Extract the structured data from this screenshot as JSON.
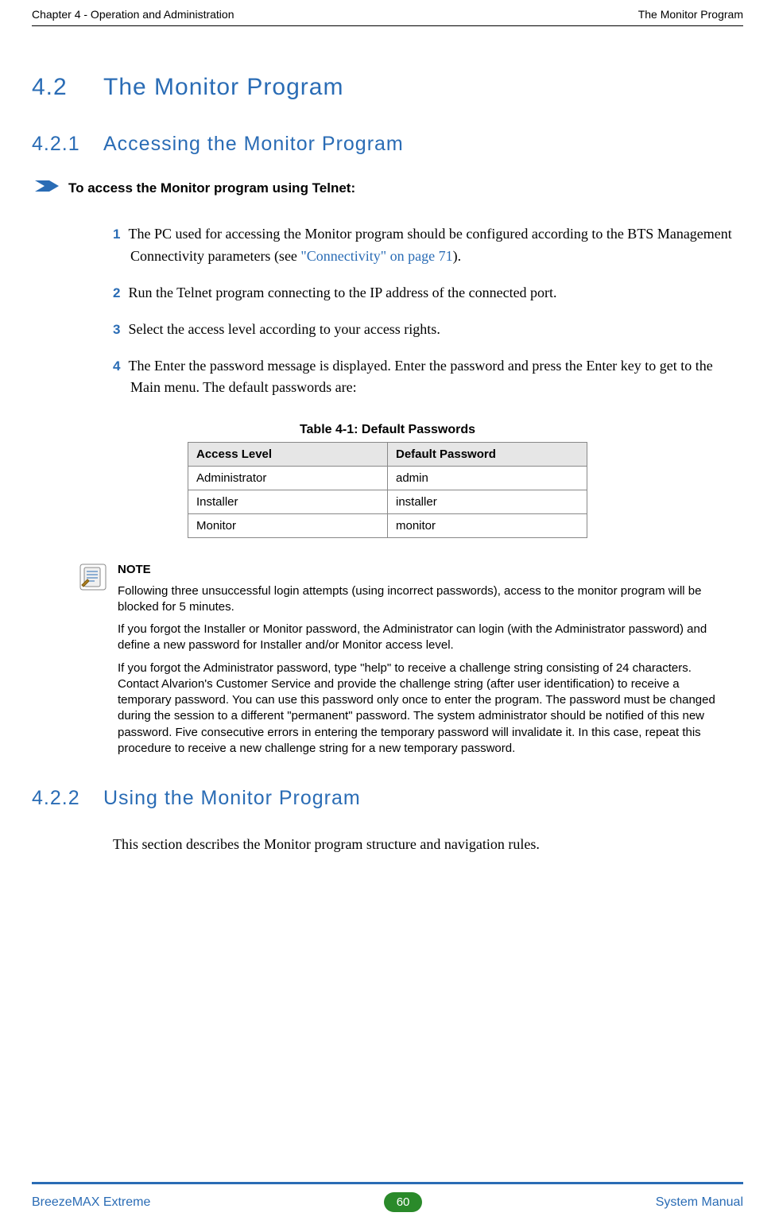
{
  "header": {
    "left": "Chapter 4 - Operation and Administration",
    "right": "The Monitor Program"
  },
  "sections": {
    "s42": {
      "num": "4.2",
      "title": "The Monitor Program"
    },
    "s421": {
      "num": "4.2.1",
      "title": "Accessing the Monitor Program"
    },
    "s422": {
      "num": "4.2.2",
      "title": "Using the Monitor Program"
    }
  },
  "task_title": "To access the Monitor program using Telnet:",
  "steps": {
    "n1": "1",
    "t1a": "The PC used for accessing the Monitor program should be configured according to the BTS Management Connectivity parameters (see ",
    "t1link": "\"Connectivity\" on page 71",
    "t1b": ").",
    "n2": "2",
    "t2": "Run the Telnet program connecting to the IP address of the connected port.",
    "n3": "3",
    "t3": "Select the access level according to your access rights.",
    "n4": "4",
    "t4": "The Enter the password message  is displayed. Enter the password and press the Enter key to get to the Main menu. The default passwords are:"
  },
  "table": {
    "caption": "Table 4-1: Default Passwords",
    "h1": "Access Level",
    "h2": "Default Password",
    "rows": [
      {
        "level": "Administrator",
        "pw": "admin"
      },
      {
        "level": "Installer",
        "pw": "installer"
      },
      {
        "level": "Monitor",
        "pw": "monitor"
      }
    ]
  },
  "note": {
    "title": "NOTE",
    "p1": "Following three unsuccessful login attempts (using incorrect passwords), access to the monitor program will be blocked for 5 minutes.",
    "p2": "If you forgot the Installer or Monitor password, the Administrator can login (with the Administrator password) and define a new password for Installer and/or Monitor access level.",
    "p3": "If you forgot the Administrator password, type \"help\" to receive a challenge string consisting of 24 characters. Contact Alvarion's Customer Service and provide the challenge string (after user identification) to receive a temporary password. You can use this password only once to enter the program. The password must be changed during the session to a different  \"permanent\" password. The system administrator should be notified of this new password. Five consecutive errors in entering the temporary password will invalidate it. In this case, repeat this procedure to receive a new challenge string for a new temporary password."
  },
  "s422_body": "This section describes the Monitor program structure and navigation rules.",
  "footer": {
    "left": "BreezeMAX Extreme",
    "page": "60",
    "right": "System Manual"
  }
}
